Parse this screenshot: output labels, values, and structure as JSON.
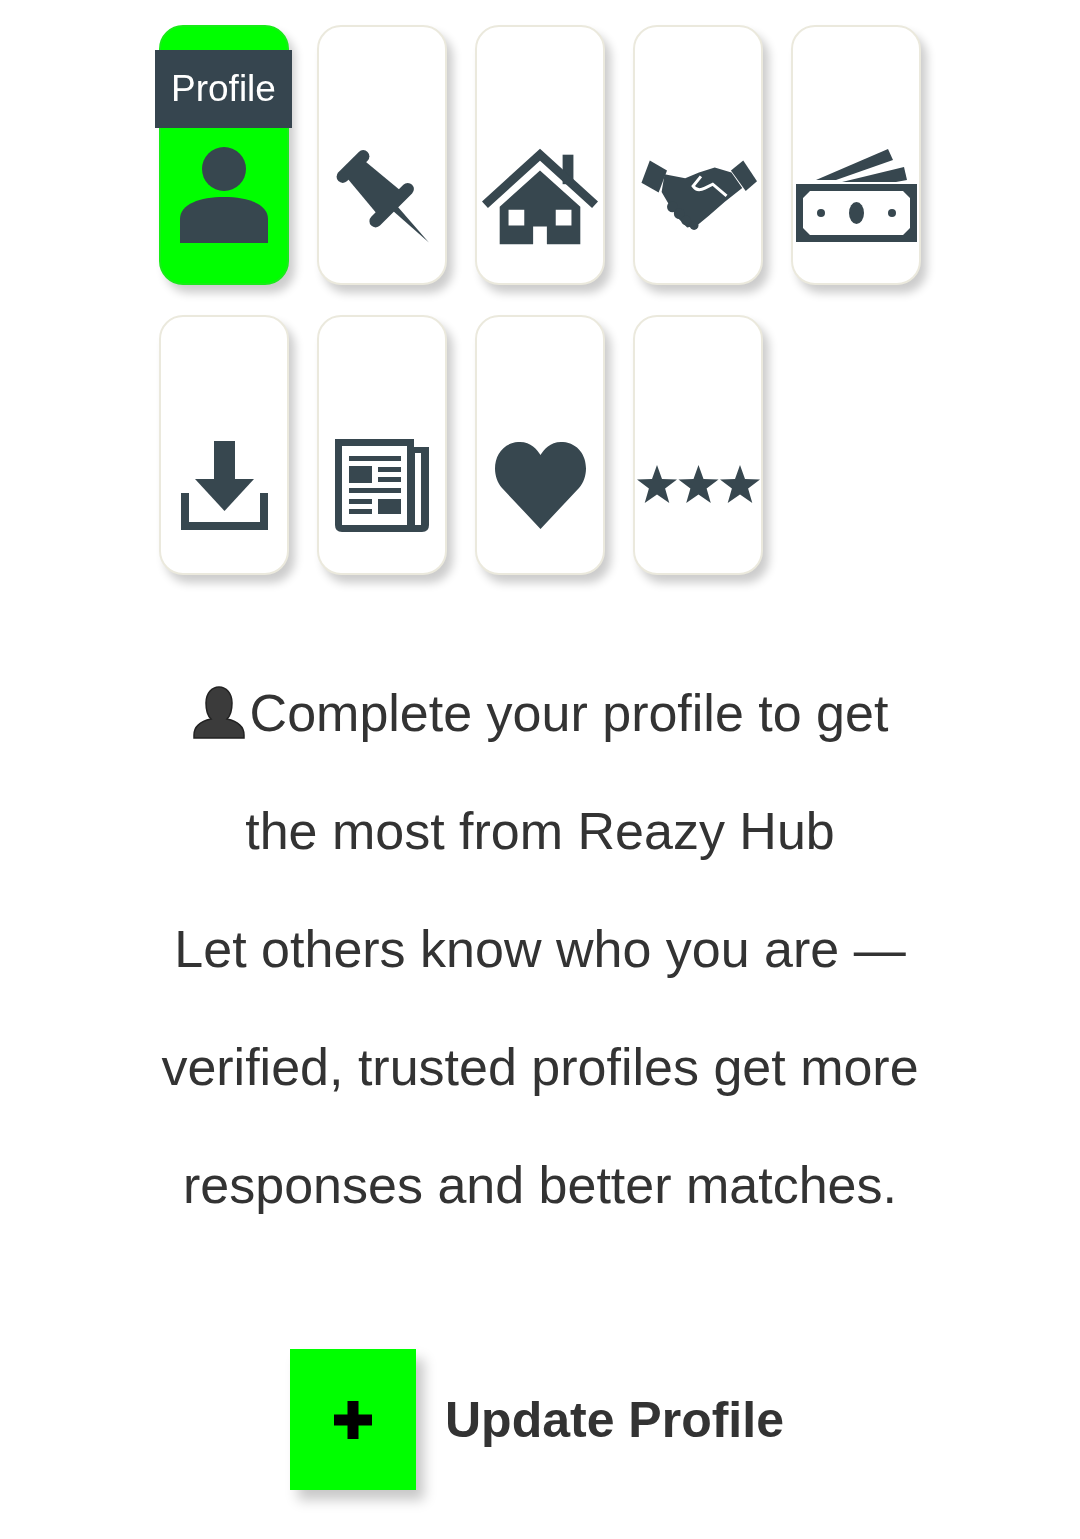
{
  "tiles": [
    {
      "kind": "person",
      "selected": true,
      "label": "Profile"
    },
    {
      "kind": "pin",
      "selected": false
    },
    {
      "kind": "house",
      "selected": false
    },
    {
      "kind": "handshake",
      "selected": false
    },
    {
      "kind": "money",
      "selected": false
    },
    {
      "kind": "download",
      "selected": false
    },
    {
      "kind": "newspaper",
      "selected": false
    },
    {
      "kind": "heart",
      "selected": false
    },
    {
      "kind": "stars",
      "selected": false
    }
  ],
  "intro": {
    "headline": "Complete your profile to get the most from Reazy Hub",
    "description": "Let others know who you are — verified, trusted profiles get more responses and better matches."
  },
  "action_button": {
    "label": "Update Profile"
  }
}
